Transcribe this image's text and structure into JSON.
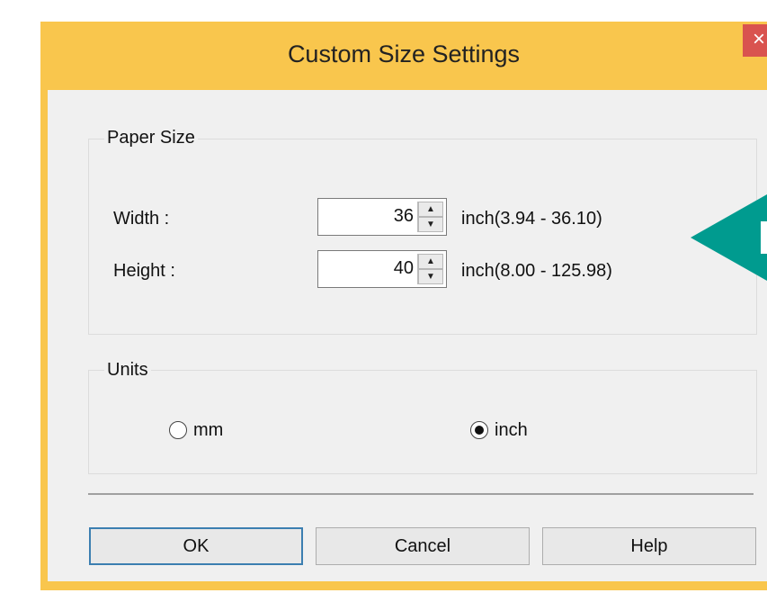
{
  "dialog": {
    "title": "Custom Size Settings",
    "close_label": "×"
  },
  "paper_size": {
    "group_label": "Paper Size",
    "width": {
      "label": "Width :",
      "value": "36",
      "range": "inch(3.94 - 36.10)"
    },
    "height": {
      "label": "Height :",
      "value": "40",
      "range": "inch(8.00 - 125.98)"
    }
  },
  "units": {
    "group_label": "Units",
    "options": [
      {
        "label": "mm",
        "selected": false
      },
      {
        "label": "inch",
        "selected": true
      }
    ]
  },
  "buttons": {
    "ok": "OK",
    "cancel": "Cancel",
    "help": "Help"
  },
  "colors": {
    "titlebar": "#f9c64d",
    "close": "#d9534f",
    "callout_arrow": "#009b8f"
  }
}
